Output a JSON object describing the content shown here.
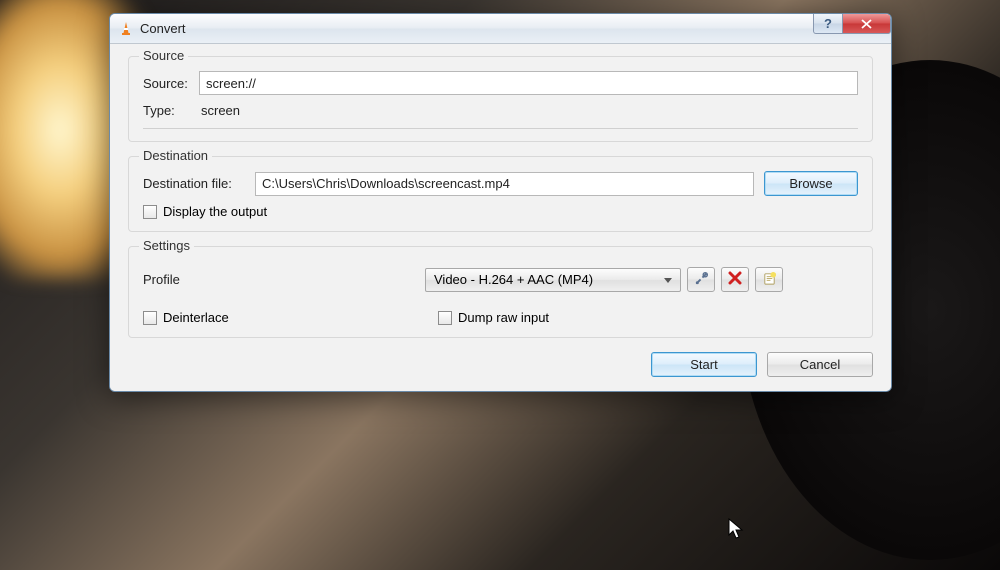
{
  "window": {
    "title": "Convert"
  },
  "source": {
    "group_label": "Source",
    "source_label": "Source:",
    "source_value": "screen://",
    "type_label": "Type:",
    "type_value": "screen"
  },
  "destination": {
    "group_label": "Destination",
    "file_label": "Destination file:",
    "file_value": "C:\\Users\\Chris\\Downloads\\screencast.mp4",
    "browse_label": "Browse",
    "display_output_label": "Display the output"
  },
  "settings": {
    "group_label": "Settings",
    "profile_label": "Profile",
    "profile_value": "Video - H.264 + AAC (MP4)",
    "deinterlace_label": "Deinterlace",
    "dump_raw_label": "Dump raw input"
  },
  "footer": {
    "start_label": "Start",
    "cancel_label": "Cancel"
  }
}
